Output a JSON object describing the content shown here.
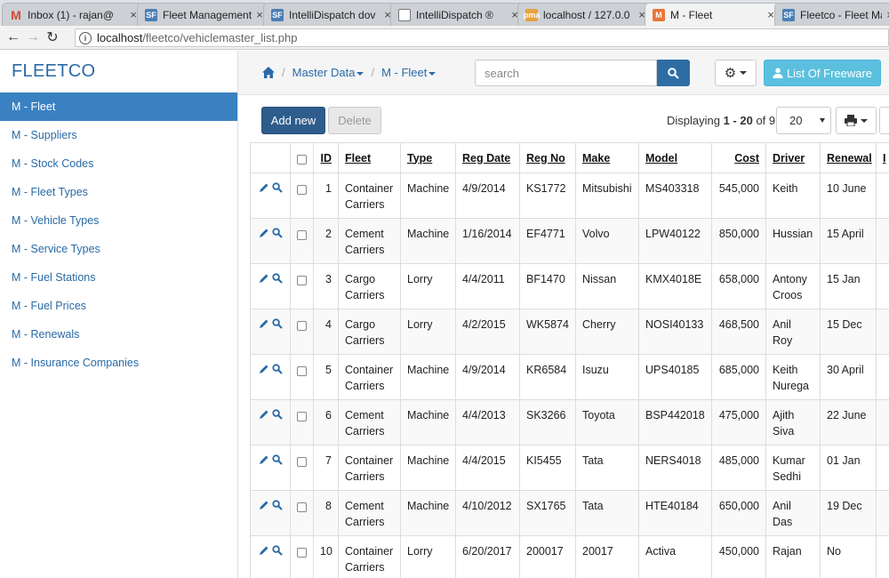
{
  "browser": {
    "tabs": [
      {
        "title": "Inbox (1) - rajan@",
        "icon": "gmail-icon",
        "color": "#d14836",
        "letter": "M",
        "active": false
      },
      {
        "title": "Fleet Management",
        "icon": "sf-icon",
        "color": "#4a7fb5",
        "letter": "SF",
        "active": false
      },
      {
        "title": "IntelliDispatch dov",
        "icon": "sf-icon",
        "color": "#4a7fb5",
        "letter": "SF",
        "active": false
      },
      {
        "title": "IntelliDispatch ®",
        "icon": "page-icon",
        "color": "#777777",
        "letter": "",
        "active": false
      },
      {
        "title": "localhost / 127.0.0",
        "icon": "phpmyadmin-icon",
        "color": "#e6a23c",
        "letter": "pma",
        "active": false
      },
      {
        "title": "M - Fleet",
        "icon": "phprunner-icon",
        "color": "#e8763a",
        "letter": "M",
        "active": true
      },
      {
        "title": "Fleetco - Fleet Mai",
        "icon": "sf-icon",
        "color": "#4a7fb5",
        "letter": "SF",
        "active": false
      }
    ],
    "url_host": "localhost",
    "url_path": "/fleetco/vehiclemaster_list.php"
  },
  "sidebar": {
    "brand": "FLEETCO",
    "items": [
      {
        "label": "M - Fleet",
        "active": true
      },
      {
        "label": "M - Suppliers"
      },
      {
        "label": "M - Stock Codes"
      },
      {
        "label": "M - Fleet Types"
      },
      {
        "label": "M - Vehicle Types"
      },
      {
        "label": "M - Service Types"
      },
      {
        "label": "M - Fuel Stations"
      },
      {
        "label": "M - Fuel Prices"
      },
      {
        "label": "M - Renewals"
      },
      {
        "label": "M - Insurance Companies"
      }
    ]
  },
  "topbar": {
    "breadcrumb": [
      "Master Data",
      "M - Fleet"
    ],
    "search_placeholder": "search",
    "freeware_label": "List Of Freeware"
  },
  "toolbar": {
    "add_label": "Add new",
    "delete_label": "Delete",
    "displaying_prefix": "Displaying ",
    "displaying_range": "1 - 20",
    "displaying_suffix": " of 9",
    "page_size": "20"
  },
  "table": {
    "columns": [
      "ID",
      "Fleet",
      "Type",
      "Reg Date",
      "Reg No",
      "Make",
      "Model",
      "Cost",
      "Driver",
      "Renewal",
      "I"
    ],
    "rows": [
      {
        "id": "1",
        "fleet": "Container Carriers",
        "type": "Machine",
        "reg_date": "4/9/2014",
        "reg_no": "KS1772",
        "make": "Mitsubishi",
        "model": "MS403318",
        "cost": "545,000",
        "driver": "Keith",
        "renewal": "10 June"
      },
      {
        "id": "2",
        "fleet": "Cement Carriers",
        "type": "Machine",
        "reg_date": "1/16/2014",
        "reg_no": "EF4771",
        "make": "Volvo",
        "model": "LPW40122",
        "cost": "850,000",
        "driver": "Hussian",
        "renewal": "15 April"
      },
      {
        "id": "3",
        "fleet": "Cargo Carriers",
        "type": "Lorry",
        "reg_date": "4/4/2011",
        "reg_no": "BF1470",
        "make": "Nissan",
        "model": "KMX4018E",
        "cost": "658,000",
        "driver": "Antony Croos",
        "renewal": "15 Jan"
      },
      {
        "id": "4",
        "fleet": "Cargo Carriers",
        "type": "Lorry",
        "reg_date": "4/2/2015",
        "reg_no": "WK5874",
        "make": "Cherry",
        "model": "NOSI40133",
        "cost": "468,500",
        "driver": "Anil Roy",
        "renewal": "15 Dec"
      },
      {
        "id": "5",
        "fleet": "Container Carriers",
        "type": "Machine",
        "reg_date": "4/9/2014",
        "reg_no": "KR6584",
        "make": "Isuzu",
        "model": "UPS40185",
        "cost": "685,000",
        "driver": "Keith Nurega",
        "renewal": "30 April"
      },
      {
        "id": "6",
        "fleet": "Cement Carriers",
        "type": "Machine",
        "reg_date": "4/4/2013",
        "reg_no": "SK3266",
        "make": "Toyota",
        "model": "BSP442018",
        "cost": "475,000",
        "driver": "Ajith Siva",
        "renewal": "22 June"
      },
      {
        "id": "7",
        "fleet": "Container Carriers",
        "type": "Machine",
        "reg_date": "4/4/2015",
        "reg_no": "KI5455",
        "make": "Tata",
        "model": "NERS4018",
        "cost": "485,000",
        "driver": "Kumar Sedhi",
        "renewal": "01 Jan"
      },
      {
        "id": "8",
        "fleet": "Cement Carriers",
        "type": "Machine",
        "reg_date": "4/10/2012",
        "reg_no": "SX1765",
        "make": "Tata",
        "model": "HTE40184",
        "cost": "650,000",
        "driver": "Anil Das",
        "renewal": "19 Dec"
      },
      {
        "id": "10",
        "fleet": "Container Carriers",
        "type": "Lorry",
        "reg_date": "6/20/2017",
        "reg_no": "200017",
        "make": "20017",
        "model": "Activa",
        "cost": "450,000",
        "driver": "Rajan",
        "renewal": "No"
      }
    ]
  }
}
